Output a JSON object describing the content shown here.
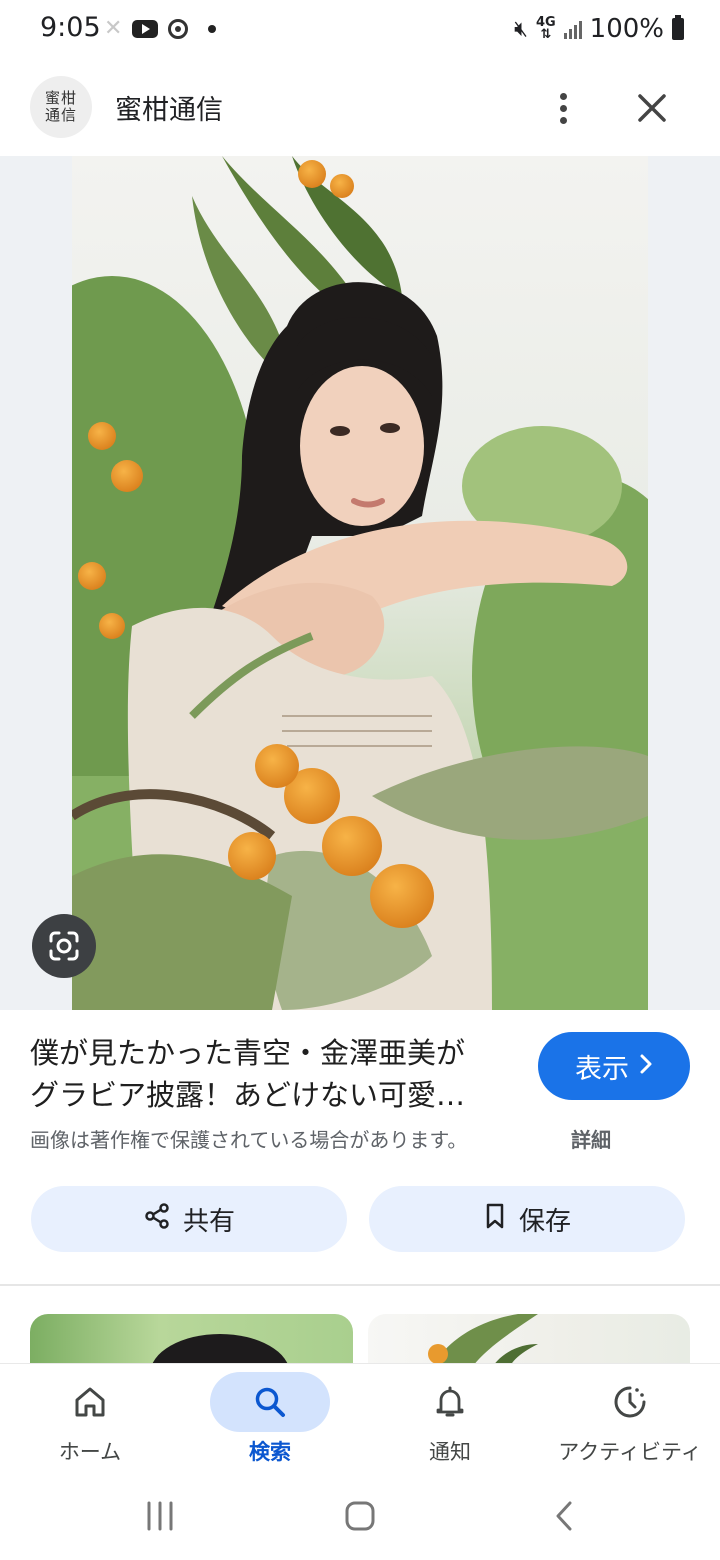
{
  "status_bar": {
    "time": "9:05",
    "network": "4G",
    "battery": "100%",
    "icons": [
      "x-app-icon",
      "youtube-icon",
      "chrome-icon",
      "notification-dot-icon",
      "mute-icon",
      "signal-icon",
      "battery-icon"
    ]
  },
  "header": {
    "avatar_text": "蜜柑通信",
    "site_name": "蜜柑通信",
    "menu_icon": "more-vert-icon",
    "close_icon": "close-icon"
  },
  "image": {
    "lens_icon": "google-lens-icon"
  },
  "result": {
    "title_line1": "僕が見たかった青空・金澤亜美が",
    "title_line2": "グラビア披露！あどけない可愛…",
    "visit_label": "表示",
    "copyright_notice": "画像は著作権で保護されている場合があります。",
    "details_label": "詳細"
  },
  "actions": {
    "share_label": "共有",
    "save_label": "保存"
  },
  "bottom_nav": {
    "items": [
      {
        "label": "ホーム",
        "icon": "home-icon"
      },
      {
        "label": "検索",
        "icon": "search-icon"
      },
      {
        "label": "通知",
        "icon": "bell-icon"
      },
      {
        "label": "アクティビティ",
        "icon": "activity-icon"
      }
    ],
    "active": "検索"
  },
  "colors": {
    "accent": "#1a73e8",
    "active_nav_text": "#0b57d0",
    "active_pill": "#d3e3fd",
    "action_button_bg": "#e8f0fe"
  }
}
